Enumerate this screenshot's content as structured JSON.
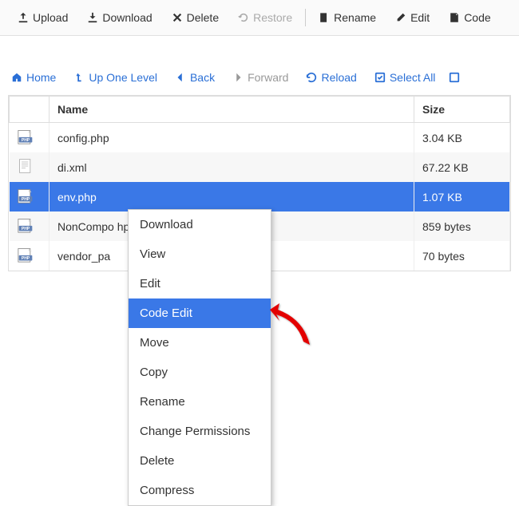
{
  "toolbar": {
    "upload": "Upload",
    "download": "Download",
    "delete": "Delete",
    "restore": "Restore",
    "rename": "Rename",
    "edit": "Edit",
    "code": "Code"
  },
  "navbar": {
    "home": "Home",
    "up": "Up One Level",
    "back": "Back",
    "forward": "Forward",
    "reload": "Reload",
    "select_all": "Select All"
  },
  "table": {
    "headers": {
      "name": "Name",
      "size": "Size"
    },
    "rows": [
      {
        "name": "config.php",
        "size": "3.04 KB",
        "type": "php",
        "selected": false
      },
      {
        "name": "di.xml",
        "size": "67.22 KB",
        "type": "xml",
        "selected": false
      },
      {
        "name": "env.php",
        "size": "1.07 KB",
        "type": "php",
        "selected": true
      },
      {
        "name": "NonComposerComponentRegistration.php",
        "size": "859 bytes",
        "type": "php",
        "selected": false,
        "name_visible": "NonCompo                              hp"
      },
      {
        "name": "vendor_path.php",
        "size": "70 bytes",
        "type": "php",
        "selected": false,
        "name_visible": "vendor_pa"
      }
    ]
  },
  "context_menu": {
    "items": [
      {
        "label": "Download",
        "highlighted": false
      },
      {
        "label": "View",
        "highlighted": false
      },
      {
        "label": "Edit",
        "highlighted": false
      },
      {
        "label": "Code Edit",
        "highlighted": true
      },
      {
        "label": "Move",
        "highlighted": false
      },
      {
        "label": "Copy",
        "highlighted": false
      },
      {
        "label": "Rename",
        "highlighted": false
      },
      {
        "label": "Change Permissions",
        "highlighted": false
      },
      {
        "label": "Delete",
        "highlighted": false
      },
      {
        "label": "Compress",
        "highlighted": false
      }
    ]
  }
}
